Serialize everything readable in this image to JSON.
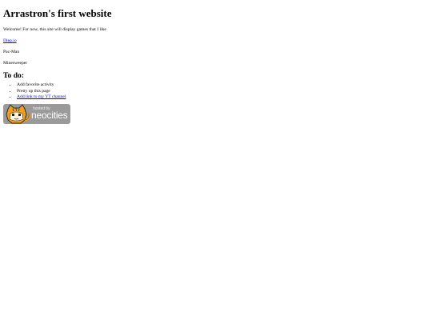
{
  "header": {
    "title": "Arrastron's first website"
  },
  "intro": {
    "text": "Welcome! For now, this site will display games that I like"
  },
  "games": {
    "diep_link": "Diep.io",
    "pacman": "Pac-Man",
    "minesweeper": "Minesweeper"
  },
  "todo": {
    "heading": "To do:",
    "items": [
      "Add favorite activity",
      "Pretty up this page",
      "Add link to my YT channel"
    ]
  },
  "badge": {
    "small_text": "hosted by",
    "big_text": "neocities",
    "icon": "neocities-cat-logo",
    "colors": {
      "background": "#9a9a9a",
      "cat": "#f0a020"
    }
  },
  "colors": {
    "link": "#0000ee",
    "text": "#000000",
    "background": "#ffffff"
  }
}
